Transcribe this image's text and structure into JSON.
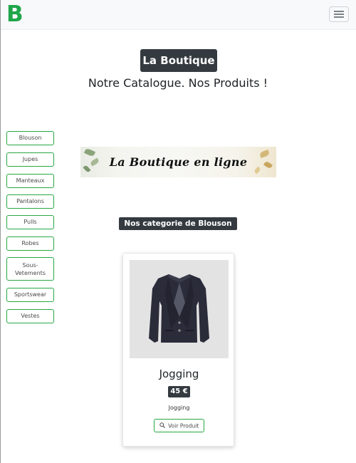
{
  "navbar": {
    "brand_letter": "B",
    "toggler_icon": "hamburger-menu-icon",
    "brand_color": "#1fa64a"
  },
  "header": {
    "title": "La Boutique",
    "subtitle": "Notre Catalogue. Nos Produits !"
  },
  "sidebar": {
    "categories": [
      {
        "label": "Blouson"
      },
      {
        "label": "Jupes"
      },
      {
        "label": "Manteaux"
      },
      {
        "label": "Pantalons"
      },
      {
        "label": "Pulls"
      },
      {
        "label": "Robes"
      },
      {
        "label": "Sous-\nVetements"
      },
      {
        "label": "Sportswear"
      },
      {
        "label": "Vestes"
      }
    ],
    "accent_color": "#28a745"
  },
  "banner": {
    "text": "La Boutique en ligne"
  },
  "section": {
    "heading": "Nos categorie de Blouson"
  },
  "products": [
    {
      "name": "Jogging",
      "price": "45 €",
      "description": "Jogging",
      "view_label": "Voir Produit",
      "view_icon": "search-icon",
      "image": "blazer-jacket"
    }
  ]
}
